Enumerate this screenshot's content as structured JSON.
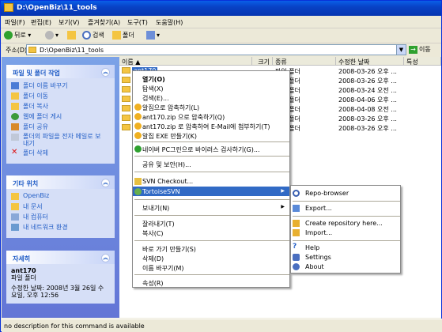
{
  "window": {
    "title": "D:\\OpenBiz\\11_tools"
  },
  "menubar": [
    "파일(F)",
    "편집(E)",
    "보기(V)",
    "즐겨찾기(A)",
    "도구(T)",
    "도움말(H)"
  ],
  "toolbar": {
    "back": "뒤로",
    "search": "검색",
    "folders": "폴더"
  },
  "address": {
    "label": "주소(D)",
    "value": "D:\\OpenBiz\\11_tools",
    "go": "이동"
  },
  "tasks_panel": {
    "title": "파일 및 폴더 작업",
    "items": [
      "폴더 이름 바꾸기",
      "폴더 이동",
      "폴더 복사",
      "웹에 폴더 게시",
      "폴더 공유",
      "폴더의 파일을 전자 메일로 보내기",
      "폴더 삭제"
    ]
  },
  "places_panel": {
    "title": "기타 위치",
    "items": [
      "OpenBiz",
      "내 문서",
      "내 컴퓨터",
      "내 네트워크 환경"
    ]
  },
  "details_panel": {
    "title": "자세히",
    "name": "ant170",
    "type": "파일 폴더",
    "modified": "수정한 날짜: 2008년 3월 26일 수요일, 오후 12:56"
  },
  "columns": [
    "이름",
    "크기",
    "종류",
    "수정한 날짜",
    "특성"
  ],
  "rows": [
    {
      "name": "ant170",
      "type": "파일 폴더",
      "date": "2008-03-26 오후 ..."
    },
    {
      "name": "",
      "type": "파일 폴더",
      "date": "2008-03-26 오후 ..."
    },
    {
      "name": "",
      "type": "파일 폴더",
      "date": "2008-03-24 오전 ..."
    },
    {
      "name": "",
      "type": "파일 폴더",
      "date": "2008-04-06 오후 ..."
    },
    {
      "name": "",
      "type": "파일 폴더",
      "date": "2008-04-08 오전 ..."
    },
    {
      "name": "",
      "type": "파일 폴더",
      "date": "2008-03-26 오후 ..."
    },
    {
      "name": "",
      "type": "파일 폴더",
      "date": "2008-03-26 오후 ..."
    }
  ],
  "context_menu": [
    {
      "label": "열기(O)",
      "bold": true
    },
    {
      "label": "탐색(X)"
    },
    {
      "label": "검색(E)..."
    },
    {
      "label": "알집으로 압축하기(L)"
    },
    {
      "label": "ant170.zip 으로 압축하기(Q)"
    },
    {
      "label": "ant170.zip 로 압축하여 E-Mail에 첨부하기(T)"
    },
    {
      "label": "알집 EXE 만들기(K)"
    },
    {
      "label": "네이버 PC그린으로 바이러스 검사하기(G)..."
    },
    {
      "label": "공유 및 보안(H)..."
    },
    {
      "label": "SVN Checkout..."
    },
    {
      "label": "TortoiseSVN"
    },
    {
      "label": "보내기(N)"
    },
    {
      "label": "잘라내기(T)"
    },
    {
      "label": "복사(C)"
    },
    {
      "label": "바로 가기 만들기(S)"
    },
    {
      "label": "삭제(D)"
    },
    {
      "label": "이름 바꾸기(M)"
    },
    {
      "label": "속성(R)"
    }
  ],
  "submenu": [
    {
      "label": "Repo-browser"
    },
    {
      "label": "Export..."
    },
    {
      "label": "Create repository here..."
    },
    {
      "label": "Import..."
    },
    {
      "label": "Help"
    },
    {
      "label": "Settings"
    },
    {
      "label": "About"
    }
  ],
  "status": {
    "text": "no description for this command is available"
  }
}
